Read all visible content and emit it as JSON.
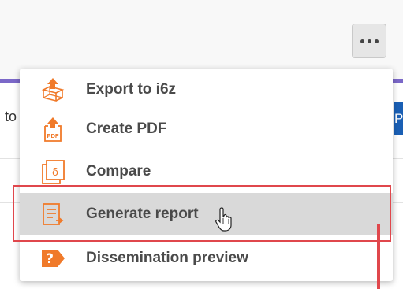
{
  "menu": {
    "items": [
      {
        "label": "Export to i6z",
        "icon": "export-cube-icon"
      },
      {
        "label": "Create PDF",
        "icon": "pdf-export-icon"
      },
      {
        "label": "Compare",
        "icon": "compare-icon"
      },
      {
        "label": "Generate report",
        "icon": "report-icon"
      },
      {
        "label": "Dissemination preview",
        "icon": "question-arrow-icon"
      }
    ]
  },
  "background": {
    "left_text": "to",
    "right_button_label": "P"
  },
  "colors": {
    "accent_orange": "#f07a2a",
    "highlight_red": "#e0474c",
    "purple_divider": "#7b68c8",
    "blue_button": "#1a5fb4"
  }
}
